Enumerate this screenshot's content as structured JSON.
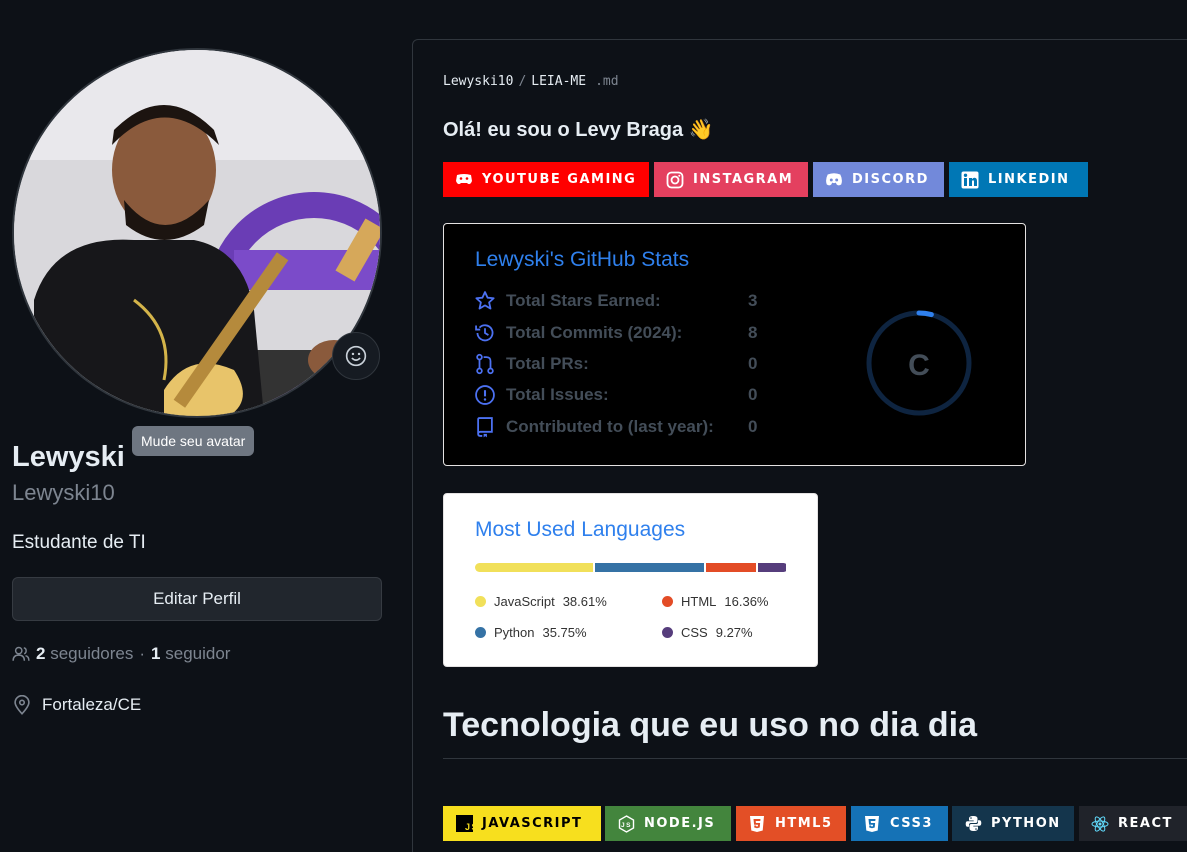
{
  "profile": {
    "avatar_tooltip": "Mude seu avatar",
    "name": "Lewyski",
    "login": "Lewyski10",
    "bio": "Estudante de TI",
    "edit_button": "Editar Perfil",
    "followers_count": "2",
    "followers_label": "seguidores",
    "separator": "·",
    "following_count": "1",
    "following_label": "seguidor",
    "location": "Fortaleza/CE"
  },
  "readme": {
    "crumb_user": "Lewyski10",
    "crumb_sep": "/",
    "crumb_file": "LEIA-ME",
    "crumb_ext": ".md",
    "greeting": "Olá! eu sou o Levy Braga 👋",
    "social_badges": [
      {
        "label": "YOUTUBE GAMING",
        "color": "#FF0000",
        "icon": "youtube-gaming-icon"
      },
      {
        "label": "INSTAGRAM",
        "color": "#E4405F",
        "icon": "instagram-icon"
      },
      {
        "label": "DISCORD",
        "color": "#7289DA",
        "icon": "discord-icon"
      },
      {
        "label": "LINKEDIN",
        "color": "#0077B5",
        "icon": "linkedin-icon"
      }
    ],
    "stats": {
      "title": "Lewyski's GitHub Stats",
      "rows": [
        {
          "label": "Total Stars Earned:",
          "value": "3",
          "icon": "star-icon"
        },
        {
          "label": "Total Commits (2024):",
          "value": "8",
          "icon": "history-icon"
        },
        {
          "label": "Total PRs:",
          "value": "0",
          "icon": "pull-request-icon"
        },
        {
          "label": "Total Issues:",
          "value": "0",
          "icon": "issue-icon"
        },
        {
          "label": "Contributed to (last year):",
          "value": "0",
          "icon": "repo-icon"
        }
      ],
      "rank": "C",
      "rank_progress": 0.04
    },
    "languages": {
      "title": "Most Used Languages",
      "items": [
        {
          "name": "JavaScript",
          "percent": "38.61%",
          "value": 38.61,
          "color": "#f1e05a"
        },
        {
          "name": "Python",
          "percent": "35.75%",
          "value": 35.75,
          "color": "#3572A5"
        },
        {
          "name": "HTML",
          "percent": "16.36%",
          "value": 16.36,
          "color": "#e34c26"
        },
        {
          "name": "CSS",
          "percent": "9.27%",
          "value": 9.27,
          "color": "#563d7c"
        }
      ]
    },
    "tech_heading": "Tecnologia que eu uso no dia dia",
    "tech_badges": [
      {
        "label": "JAVASCRIPT",
        "color": "#F7DF1E",
        "text_color": "#000000",
        "icon": "javascript-icon"
      },
      {
        "label": "NODE.JS",
        "color": "#43853D",
        "text_color": "#FFFFFF",
        "icon": "nodejs-icon"
      },
      {
        "label": "HTML5",
        "color": "#E34F26",
        "text_color": "#FFFFFF",
        "icon": "html5-icon"
      },
      {
        "label": "CSS3",
        "color": "#1572B6",
        "text_color": "#FFFFFF",
        "icon": "css3-icon"
      },
      {
        "label": "PYTHON",
        "color": "#14354C",
        "text_color": "#FFFFFF",
        "icon": "python-icon"
      },
      {
        "label": "REACT",
        "color": "#20232A",
        "text_color": "#FFFFFF",
        "icon": "react-icon"
      }
    ]
  }
}
